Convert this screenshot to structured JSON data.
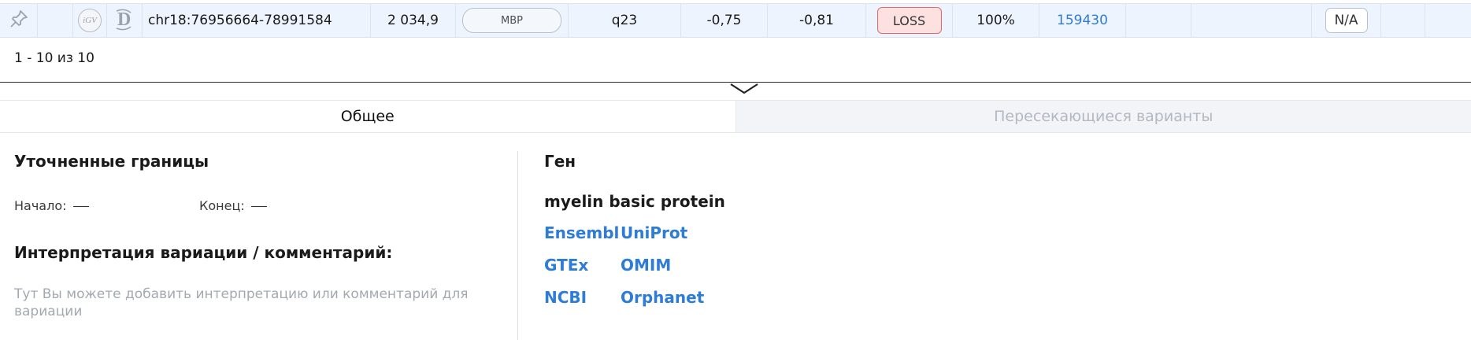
{
  "row": {
    "pin_icon": "pin-icon",
    "igv_label": "iGV",
    "d_icon": "decipher-icon",
    "coordinates": "chr18:76956664-78991584",
    "size": "2 034,9",
    "gene": "MBP",
    "band": "q23",
    "score1": "-0,75",
    "score2": "-0,81",
    "type": "LOSS",
    "percent": "100%",
    "id": "159430",
    "na": "N/A"
  },
  "pagination": "1 - 10 из 10",
  "tabs": [
    {
      "label": "Общее",
      "active": true
    },
    {
      "label": "Пересекающиеся варианты",
      "active": false
    }
  ],
  "left": {
    "refined_bounds_title": "Уточненные границы",
    "start_label": "Начало:",
    "end_label": "Конец:",
    "interpretation_title": "Интерпретация вариации / комментарий:",
    "interpretation_placeholder": "Тут Вы можете добавить интерпретацию или комментарий для вариации"
  },
  "right": {
    "gene_title": "Ген",
    "gene_name": "myelin basic protein",
    "links": [
      "Ensembl",
      "UniProt",
      "GTEx",
      "OMIM",
      "NCBI",
      "Orphanet"
    ]
  },
  "colors": {
    "link": "#2d7cd6",
    "loss_bg": "#fde1e1",
    "loss_border": "#e06a6a",
    "row_bg": "#eef4fd"
  }
}
